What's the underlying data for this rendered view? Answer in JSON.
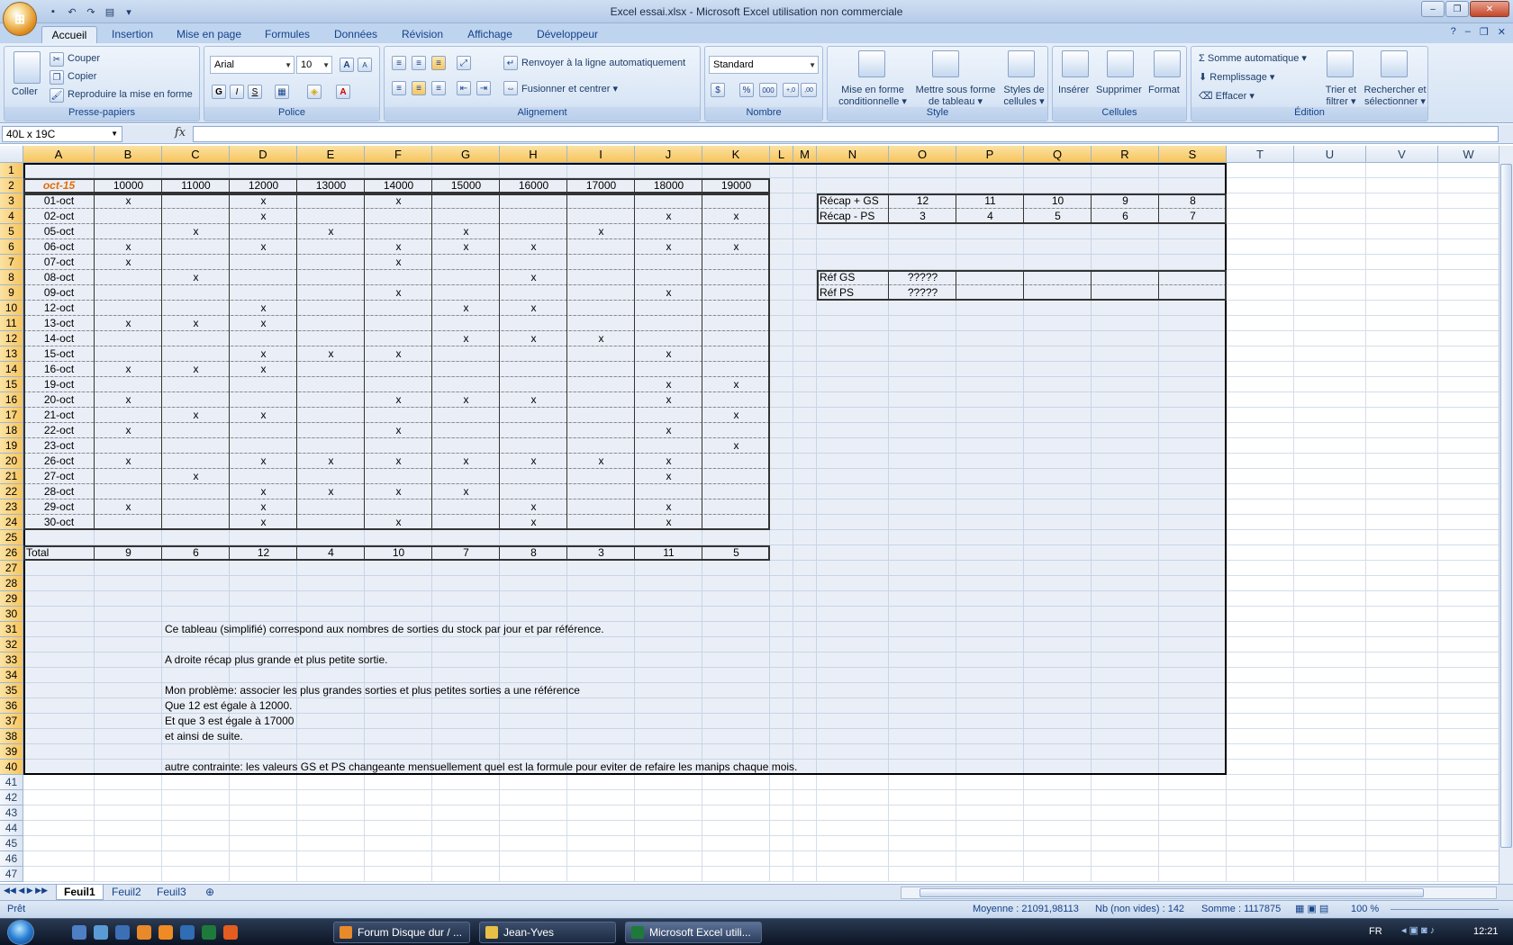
{
  "window": {
    "title": "Excel essai.xlsx - Microsoft Excel utilisation non commerciale",
    "minimize": "–",
    "maximize": "❐",
    "close": "✕"
  },
  "office_button": {
    "label": "⊞"
  },
  "qat": {
    "save": "▪",
    "undo": "↶",
    "redo": "↷",
    "print": "▤",
    "more": "▾"
  },
  "tabs": [
    "Accueil",
    "Insertion",
    "Mise en page",
    "Formules",
    "Données",
    "Révision",
    "Affichage",
    "Développeur"
  ],
  "tabs_right": {
    "help": "?",
    "min": "–",
    "restore": "❐",
    "close": "✕"
  },
  "ribbon": {
    "clipboard": {
      "label": "Presse-papiers",
      "paste": "Coller",
      "cut": "Couper",
      "copy": "Copier",
      "format_painter": "Reproduire la mise en forme"
    },
    "font": {
      "label": "Police",
      "name": "Arial",
      "size": "10",
      "grow": "A",
      "shrink": "A",
      "bold": "G",
      "italic": "I",
      "underline": "S",
      "fill": "◈",
      "color": "A"
    },
    "alignment": {
      "label": "Alignement",
      "wrap": "Renvoyer à la ligne automatiquement",
      "merge": "Fusionner et centrer"
    },
    "number": {
      "label": "Nombre",
      "format": "Standard",
      "currency": "$",
      "percent": "%",
      "thousands": "000",
      "inc_decimal": "+,0",
      "dec_decimal": ",00"
    },
    "style": {
      "label": "Style",
      "conditional_line1": "Mise en forme",
      "conditional_line2": "conditionnelle",
      "table_line1": "Mettre sous forme",
      "table_line2": "de tableau",
      "cell_styles_line1": "Styles de",
      "cell_styles_line2": "cellules"
    },
    "cells": {
      "label": "Cellules",
      "insert": "Insérer",
      "delete": "Supprimer",
      "format": "Format"
    },
    "editing": {
      "label": "Édition",
      "autosum": "Somme automatique",
      "fill": "Remplissage",
      "clear": "Effacer",
      "sort_line1": "Trier et",
      "sort_line2": "filtrer",
      "find_line1": "Rechercher et",
      "find_line2": "sélectionner"
    }
  },
  "formula_bar": {
    "name_box": "40L x 19C",
    "fx": "fx",
    "value": ""
  },
  "columns": [
    "A",
    "B",
    "C",
    "D",
    "E",
    "F",
    "G",
    "H",
    "I",
    "J",
    "K",
    "L",
    "M",
    "N",
    "O",
    "P",
    "Q",
    "R",
    "S",
    "T",
    "U",
    "V",
    "W"
  ],
  "rows": [
    "1",
    "2",
    "3",
    "4",
    "5",
    "6",
    "7",
    "8",
    "9",
    "10",
    "11",
    "12",
    "13",
    "14",
    "15",
    "16",
    "17",
    "18",
    "19",
    "20",
    "21",
    "22",
    "23",
    "24",
    "25",
    "26",
    "27",
    "28",
    "29",
    "30",
    "31",
    "32",
    "33",
    "34",
    "35",
    "36",
    "37",
    "38",
    "39",
    "40",
    "41",
    "42",
    "43",
    "44",
    "45",
    "46",
    "47"
  ],
  "sheet": {
    "main_table": {
      "header_label": "oct-15",
      "refs": [
        "10000",
        "11000",
        "12000",
        "13000",
        "14000",
        "15000",
        "16000",
        "17000",
        "18000",
        "19000"
      ],
      "dates": [
        "01-oct",
        "02-oct",
        "05-oct",
        "06-oct",
        "07-oct",
        "08-oct",
        "09-oct",
        "12-oct",
        "13-oct",
        "14-oct",
        "15-oct",
        "16-oct",
        "19-oct",
        "20-oct",
        "21-oct",
        "22-oct",
        "23-oct",
        "26-oct",
        "27-oct",
        "28-oct",
        "29-oct",
        "30-oct"
      ],
      "marks": [
        [
          1,
          0,
          1,
          0,
          1,
          0,
          0,
          0,
          0,
          0
        ],
        [
          0,
          0,
          1,
          0,
          0,
          0,
          0,
          0,
          1,
          1
        ],
        [
          0,
          1,
          0,
          1,
          0,
          1,
          0,
          1,
          0,
          0
        ],
        [
          1,
          0,
          1,
          0,
          1,
          1,
          1,
          0,
          1,
          1
        ],
        [
          1,
          0,
          0,
          0,
          1,
          0,
          0,
          0,
          0,
          0
        ],
        [
          0,
          1,
          0,
          0,
          0,
          0,
          1,
          0,
          0,
          0
        ],
        [
          0,
          0,
          0,
          0,
          1,
          0,
          0,
          0,
          1,
          0
        ],
        [
          0,
          0,
          1,
          0,
          0,
          1,
          1,
          0,
          0,
          0
        ],
        [
          1,
          1,
          1,
          0,
          0,
          0,
          0,
          0,
          0,
          0
        ],
        [
          0,
          0,
          0,
          0,
          0,
          1,
          1,
          1,
          0,
          0
        ],
        [
          0,
          0,
          1,
          1,
          1,
          0,
          0,
          0,
          1,
          0
        ],
        [
          1,
          1,
          1,
          0,
          0,
          0,
          0,
          0,
          0,
          0
        ],
        [
          0,
          0,
          0,
          0,
          0,
          0,
          0,
          0,
          1,
          1
        ],
        [
          1,
          0,
          0,
          0,
          1,
          1,
          1,
          0,
          1,
          0
        ],
        [
          0,
          1,
          1,
          0,
          0,
          0,
          0,
          0,
          0,
          1
        ],
        [
          1,
          0,
          0,
          0,
          1,
          0,
          0,
          0,
          1,
          0
        ],
        [
          0,
          0,
          0,
          0,
          0,
          0,
          0,
          0,
          0,
          1
        ],
        [
          1,
          0,
          1,
          1,
          1,
          1,
          1,
          1,
          1,
          0
        ],
        [
          0,
          1,
          0,
          0,
          0,
          0,
          0,
          0,
          1,
          0
        ],
        [
          0,
          0,
          1,
          1,
          1,
          1,
          0,
          0,
          0,
          0
        ],
        [
          1,
          0,
          1,
          0,
          0,
          0,
          1,
          0,
          1,
          0
        ],
        [
          0,
          0,
          1,
          0,
          1,
          0,
          1,
          0,
          1,
          0
        ]
      ],
      "mark_symbol": "x",
      "total_label": "Total",
      "totals": [
        "9",
        "6",
        "12",
        "4",
        "10",
        "7",
        "8",
        "3",
        "11",
        "5"
      ]
    },
    "recap": {
      "rows": [
        {
          "label": "Récap + GS",
          "values": [
            "12",
            "11",
            "10",
            "9",
            "8"
          ]
        },
        {
          "label": "Récap - PS",
          "values": [
            "3",
            "4",
            "5",
            "6",
            "7"
          ]
        }
      ]
    },
    "ref": {
      "rows": [
        {
          "label": "Réf  GS",
          "value": "?????"
        },
        {
          "label": "Réf  PS",
          "value": "?????"
        }
      ]
    },
    "notes": [
      {
        "row": 31,
        "text": "Ce tableau (simplifié) correspond aux nombres de sorties du stock par jour et par référence."
      },
      {
        "row": 33,
        "text": "A droite récap plus grande et plus petite sortie."
      },
      {
        "row": 35,
        "text": "Mon problème:  associer les plus grandes sorties et plus petites sorties a une référence"
      },
      {
        "row": 36,
        "text": "Que 12 est égale à 12000."
      },
      {
        "row": 37,
        "text": "Et que 3 est égale à 17000"
      },
      {
        "row": 38,
        "text": "et ainsi de suite."
      },
      {
        "row": 40,
        "text": "autre contrainte: les valeurs GS et PS changeante mensuellement  quel est la formule pour eviter de refaire les manips chaque mois."
      }
    ]
  },
  "sheet_tabs": [
    "Feuil1",
    "Feuil2",
    "Feuil3"
  ],
  "status": {
    "ready": "Prêt",
    "average": "Moyenne : 21091,98113",
    "count": "Nb (non vides) : 142",
    "sum": "Somme : 1117875",
    "zoom": "100 %"
  },
  "taskbar": {
    "buttons": [
      "Forum Disque dur / ...",
      "Jean-Yves",
      "Microsoft Excel utili..."
    ],
    "lang": "FR",
    "clock": "12:21"
  },
  "colors": {
    "accent_orange": "#e36c09",
    "selection": "#f7c45e",
    "ribbon_text": "#15428b"
  }
}
